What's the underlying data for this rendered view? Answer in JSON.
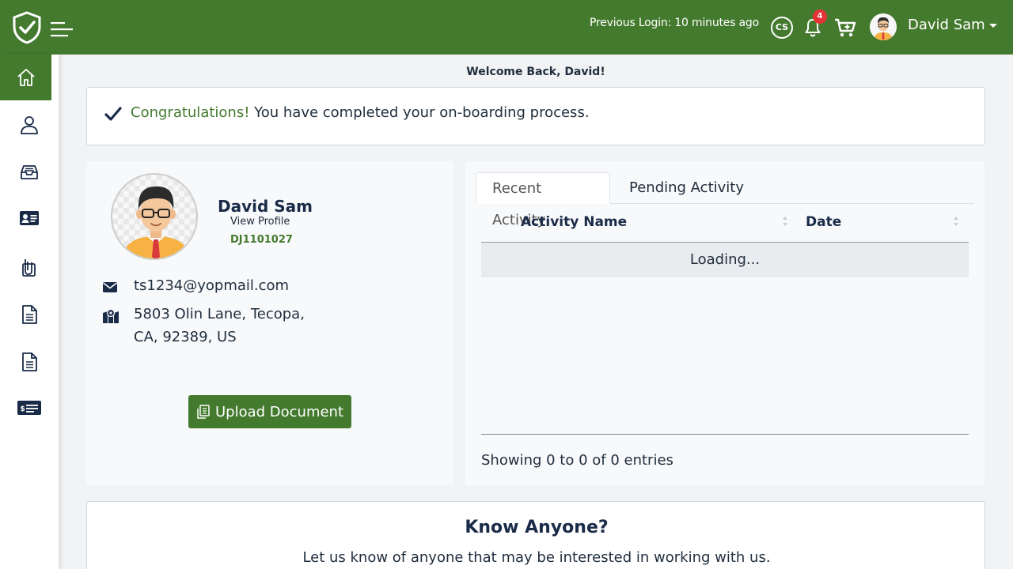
{
  "header": {
    "previous_login": "Previous Login: 10 minutes ago",
    "cs_label": "CS",
    "notification_count": "4",
    "username": "David Sam",
    "brand_color": "#447a2e"
  },
  "sidebar": {
    "items": [
      {
        "icon": "home-icon",
        "active": true
      },
      {
        "icon": "user-icon",
        "active": false
      },
      {
        "icon": "inbox-icon",
        "active": false
      },
      {
        "icon": "id-card-icon",
        "active": false
      },
      {
        "icon": "clipboard-icon",
        "active": false
      },
      {
        "icon": "document-icon",
        "active": false
      },
      {
        "icon": "document-icon",
        "active": false
      },
      {
        "icon": "payment-card-icon",
        "active": false
      }
    ]
  },
  "main": {
    "welcome": "Welcome Back, David!",
    "alert": {
      "highlight": "Congratulations!",
      "message": " You have completed your on-boarding process."
    }
  },
  "profile": {
    "name": "David Sam",
    "view_profile": "View Profile",
    "id": "DJ1101027",
    "email": "ts1234@yopmail.com",
    "address_line1": "5803 Olin Lane, Tecopa,",
    "address_line2": "CA, 92389, US",
    "upload_button": "Upload Document"
  },
  "activity": {
    "tabs": [
      "Recent Activity",
      "Pending Activity"
    ],
    "columns": [
      "Activity Name",
      "Date"
    ],
    "loading": "Loading...",
    "info": "Showing 0 to 0 of 0 entries"
  },
  "know": {
    "title": "Know Anyone?",
    "subtitle": "Let us know of anyone that may be interested in working with us."
  }
}
